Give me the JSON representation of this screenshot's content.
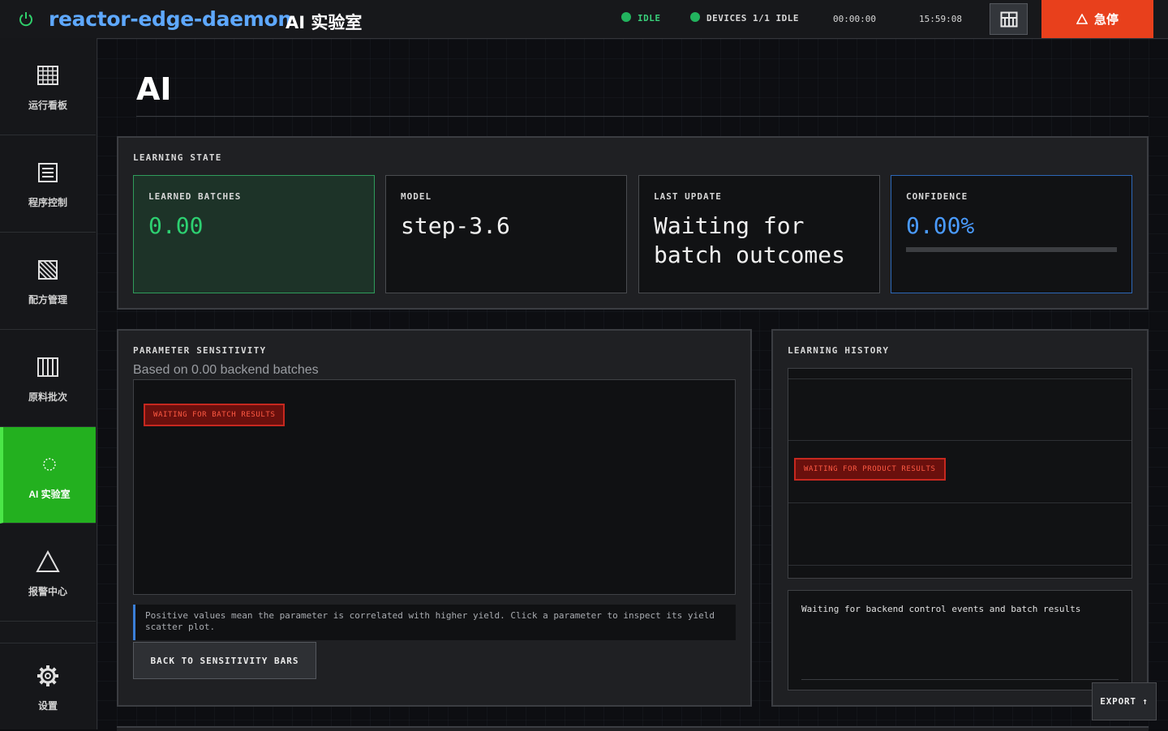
{
  "header": {
    "app_name": "reactor-edge-daemon",
    "page_label": "AI 实验室",
    "status": "IDLE",
    "devices": "DEVICES 1/1 IDLE",
    "timer": "00:00:00",
    "clock": "15:59:08",
    "estop_label": "急停",
    "status_color": "#22b35e",
    "estop_color": "#e8401c"
  },
  "sidebar": {
    "items": [
      {
        "label": "运行看板",
        "icon": "dashboard-grid-icon"
      },
      {
        "label": "程序控制",
        "icon": "program-list-icon"
      },
      {
        "label": "配方管理",
        "icon": "recipe-hatch-icon"
      },
      {
        "label": "原料批次",
        "icon": "batch-bars-icon"
      },
      {
        "label": "AI 实验室",
        "icon": "ai-spinner-icon",
        "active": true
      },
      {
        "label": "报警中心",
        "icon": "alarm-triangle-icon"
      }
    ],
    "settings_label": "设置",
    "active_color": "#23b01f"
  },
  "page": {
    "title": "AI"
  },
  "learning_state": {
    "title": "LEARNING STATE",
    "cards": [
      {
        "label": "LEARNED BATCHES",
        "value": "0.00"
      },
      {
        "label": "MODEL",
        "value": "step-3.6"
      },
      {
        "label": "LAST UPDATE",
        "value": "Waiting for batch outcomes"
      },
      {
        "label": "CONFIDENCE",
        "value": "0.00%",
        "progress": 0
      }
    ]
  },
  "sensitivity": {
    "title": "PARAMETER SENSITIVITY",
    "subtitle": "Based on 0.00 backend batches",
    "badge": "WAITING FOR BATCH RESULTS",
    "hint": "Positive values mean the parameter is correlated with higher yield. Click a parameter to inspect its yield scatter plot.",
    "back_button": "BACK TO SENSITIVITY BARS"
  },
  "history": {
    "title": "LEARNING HISTORY",
    "badge": "WAITING FOR PRODUCT RESULTS",
    "log_text": "Waiting for backend control events and batch results"
  },
  "export_label": "EXPORT ↑"
}
